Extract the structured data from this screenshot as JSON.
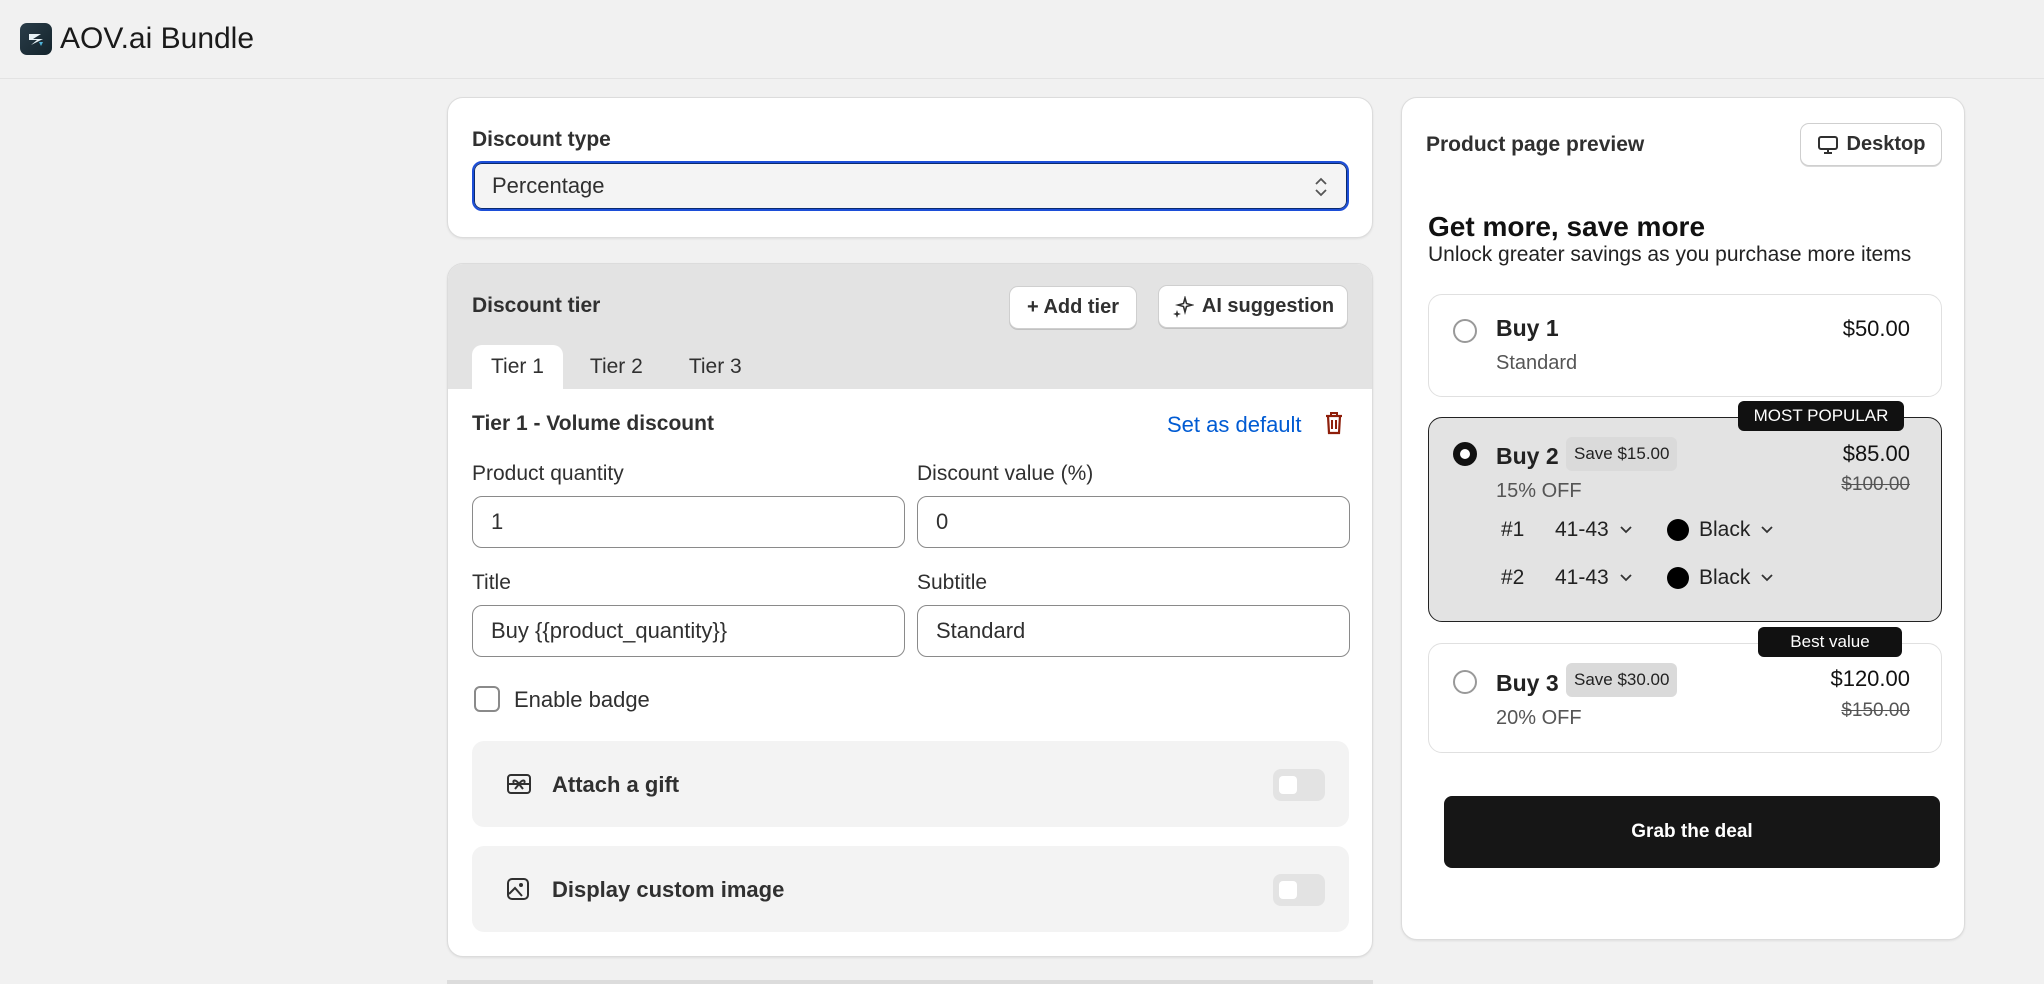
{
  "app": {
    "title": "AOV.ai Bundle"
  },
  "discount_type": {
    "label": "Discount type",
    "selected": "Percentage"
  },
  "tier_section": {
    "label": "Discount tier",
    "add_tier_label": "+ Add tier",
    "ai_suggestion_label": "AI suggestion",
    "tabs": [
      "Tier 1",
      "Tier 2",
      "Tier 3"
    ],
    "active_tab": "Tier 1",
    "tier_title": "Tier 1 - Volume discount",
    "set_default_label": "Set as default",
    "fields": {
      "product_quantity": {
        "label": "Product quantity",
        "value": "1"
      },
      "discount_value": {
        "label": "Discount value (%)",
        "value": "0"
      },
      "title": {
        "label": "Title",
        "value": "Buy {{product_quantity}}"
      },
      "subtitle": {
        "label": "Subtitle",
        "value": "Standard"
      }
    },
    "enable_badge": {
      "label": "Enable badge",
      "checked": false
    },
    "attach_gift": {
      "label": "Attach a gift",
      "enabled": false
    },
    "custom_image": {
      "label": "Display custom image",
      "enabled": false
    }
  },
  "preview": {
    "title": "Product page preview",
    "device_label": "Desktop",
    "headline": "Get more, save more",
    "subheadline": "Unlock greater savings as you purchase more items",
    "options": [
      {
        "name": "Buy 1",
        "subtitle": "Standard",
        "price": "$50.00",
        "selected": false
      },
      {
        "name": "Buy 2",
        "save": "Save $15.00",
        "subtitle": "15% OFF",
        "price": "$85.00",
        "old_price": "$100.00",
        "badge": "MOST POPULAR",
        "selected": true,
        "variants": [
          {
            "index": "#1",
            "size": "41-43",
            "color": "Black"
          },
          {
            "index": "#2",
            "size": "41-43",
            "color": "Black"
          }
        ]
      },
      {
        "name": "Buy 3",
        "save": "Save $30.00",
        "subtitle": "20% OFF",
        "price": "$120.00",
        "old_price": "$150.00",
        "badge": "Best value",
        "selected": false
      }
    ],
    "cta_label": "Grab the deal"
  },
  "colors": {
    "accent": "#1c4ed8",
    "link": "#005bd3",
    "danger": "#8e1f0b",
    "cta": "#161616"
  }
}
